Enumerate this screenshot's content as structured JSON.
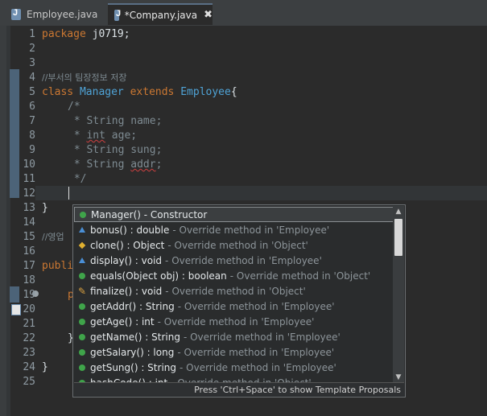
{
  "tabs": [
    {
      "label": "Employee.java",
      "active": false
    },
    {
      "label": "*Company.java",
      "active": true,
      "close": "✖"
    }
  ],
  "line_numbers": [
    "1",
    "2",
    "3",
    "4",
    "5",
    "6",
    "7",
    "8",
    "9",
    "10",
    "11",
    "12",
    "13",
    "14",
    "15",
    "16",
    "17",
    "18",
    "19",
    "20",
    "21",
    "22",
    "23",
    "24",
    "25"
  ],
  "code": {
    "l1_kw": "package",
    "l1_rest": " j0719;",
    "l4": "//부서의 팀장정보 저장",
    "l5_kw1": "class",
    "l5_cls1": "Manager",
    "l5_kw2": "extends",
    "l5_cls2": "Employee",
    "l5_rest": "{",
    "l6": "/*",
    "l7": " * String name;",
    "l8_a": " * ",
    "l8_b": "int",
    "l8_c": " age;",
    "l9": " * String sung;",
    "l10_a": " * String ",
    "l10_b": "addr",
    "l10_c": ";",
    "l11": " */",
    "l13": "}",
    "l15": "//영업",
    "l17": "publi",
    "l19": "p",
    "l22": "}",
    "l24": "}"
  },
  "popup": {
    "items": [
      {
        "icon": "constructor-icon",
        "sig": "Manager() - Constructor",
        "desc": ""
      },
      {
        "icon": "protected-method-icon",
        "sig": "bonus() : double",
        "desc": "- Override method in 'Employee'"
      },
      {
        "icon": "default-method-icon",
        "sig": "clone() : Object",
        "desc": "- Override method in 'Object'"
      },
      {
        "icon": "protected-method-icon",
        "sig": "display() : void",
        "desc": "- Override method in 'Employee'"
      },
      {
        "icon": "public-method-icon",
        "sig": "equals(Object obj) : boolean",
        "desc": "- Override method in 'Object'"
      },
      {
        "icon": "brush-icon",
        "sig": "finalize() : void",
        "desc": "- Override method in 'Object'"
      },
      {
        "icon": "public-method-icon",
        "sig": "getAddr() : String",
        "desc": "- Override method in 'Employee'"
      },
      {
        "icon": "public-method-icon",
        "sig": "getAge() : int",
        "desc": "- Override method in 'Employee'"
      },
      {
        "icon": "public-method-icon",
        "sig": "getName() : String",
        "desc": "- Override method in 'Employee'"
      },
      {
        "icon": "public-method-icon",
        "sig": "getSalary() : long",
        "desc": "- Override method in 'Employee'"
      },
      {
        "icon": "public-method-icon",
        "sig": "getSung() : String",
        "desc": "- Override method in 'Employee'"
      },
      {
        "icon": "public-method-icon",
        "sig": "hashCode() : int",
        "desc": "- Override method in 'Object'"
      }
    ],
    "status": "Press 'Ctrl+Space' to show Template Proposals",
    "scroll_up": "▲",
    "scroll_down": "▼"
  },
  "colors": {
    "background": "#2b2b2b",
    "keyword": "#cc7832",
    "class_name": "#4fa3d6",
    "comment": "#7e8b92"
  }
}
